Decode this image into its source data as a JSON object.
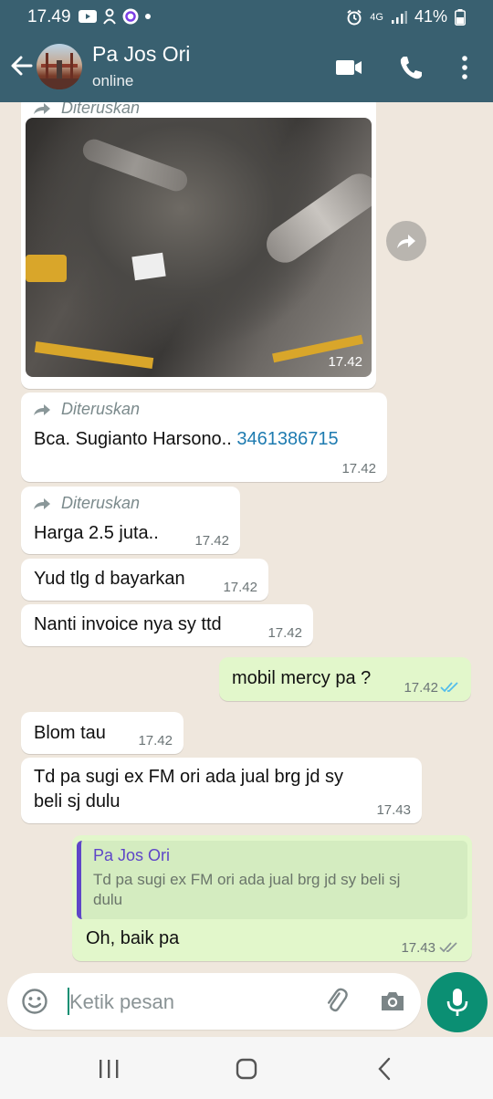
{
  "status_bar": {
    "time": "17.49",
    "network": "4G",
    "battery": "41%"
  },
  "header": {
    "contact_name": "Pa Jos Ori",
    "status": "online"
  },
  "messages": [
    {
      "type": "image",
      "direction": "in",
      "forwarded_label": "Diteruskan",
      "time": "17.42"
    },
    {
      "type": "text",
      "direction": "in",
      "forwarded_label": "Diteruskan",
      "text": "Bca. Sugianto Harsono..",
      "link": "3461386715",
      "time": "17.42"
    },
    {
      "type": "text",
      "direction": "in",
      "forwarded_label": "Diteruskan",
      "text": "Harga 2.5 juta..",
      "time": "17.42"
    },
    {
      "type": "text",
      "direction": "in",
      "text": "Yud tlg d bayarkan",
      "time": "17.42"
    },
    {
      "type": "text",
      "direction": "in",
      "text": "Nanti invoice nya sy ttd",
      "time": "17.42"
    },
    {
      "type": "text",
      "direction": "out",
      "text": "mobil mercy pa ?",
      "time": "17.42",
      "read": true
    },
    {
      "type": "text",
      "direction": "in",
      "text": "Blom tau",
      "time": "17.42"
    },
    {
      "type": "text",
      "direction": "in",
      "text_line1": "Td pa sugi ex FM ori ada jual brg jd sy",
      "text_line2": "beli sj dulu",
      "time": "17.43"
    },
    {
      "type": "reply",
      "direction": "out",
      "quoted_name": "Pa Jos Ori",
      "quoted_line1": "Td pa sugi ex FM ori ada jual brg jd sy beli sj",
      "quoted_line2": "dulu",
      "text": "Oh, baik pa",
      "time": "17.43",
      "read": false
    }
  ],
  "input": {
    "placeholder": "Ketik pesan"
  },
  "colors": {
    "header": "#396070",
    "chat_background": "#efe7dd",
    "outgoing_bubble": "#e2f7cb",
    "accent": "#0b8f73",
    "link": "#1e7bb0",
    "read_ticks": "#53bdeb"
  },
  "icons": {
    "back": "arrow-left-icon",
    "video": "video-camera-icon",
    "call": "phone-icon",
    "menu": "more-vert-icon",
    "forward": "forward-arrow-icon",
    "emoji": "emoji-icon",
    "attach": "paperclip-icon",
    "camera": "camera-icon",
    "mic": "microphone-icon"
  }
}
